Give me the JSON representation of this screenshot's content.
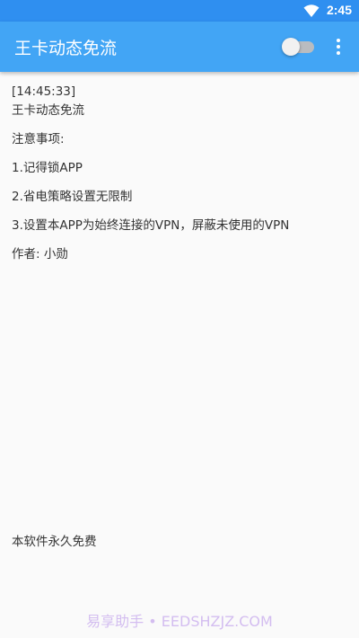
{
  "status_bar": {
    "time": "2:45",
    "wifi_icon": "wifi-icon"
  },
  "app_bar": {
    "title": "王卡动态免流",
    "toggle_state": "off",
    "menu_icon": "more-vert-icon"
  },
  "log": {
    "timestamp": "[14:45:33]",
    "app_name": "王卡动态免流",
    "notice_heading": "注意事项:",
    "note_1": "1.记得锁APP",
    "note_2": "2.省电策略设置无限制",
    "note_3": "3.设置本APP为始终连接的VPN，屏蔽未使用的VPN",
    "author": "作者: 小勋"
  },
  "footer": {
    "free_notice": "本软件永久免费"
  },
  "watermark": {
    "text": "易享助手 • EEDSHZJZ.COM"
  },
  "colors": {
    "status_bar": "#2f8ff0",
    "app_bar": "#42a5f5",
    "background": "#fafafa",
    "text": "#333333",
    "watermark": "#b58ce8"
  }
}
